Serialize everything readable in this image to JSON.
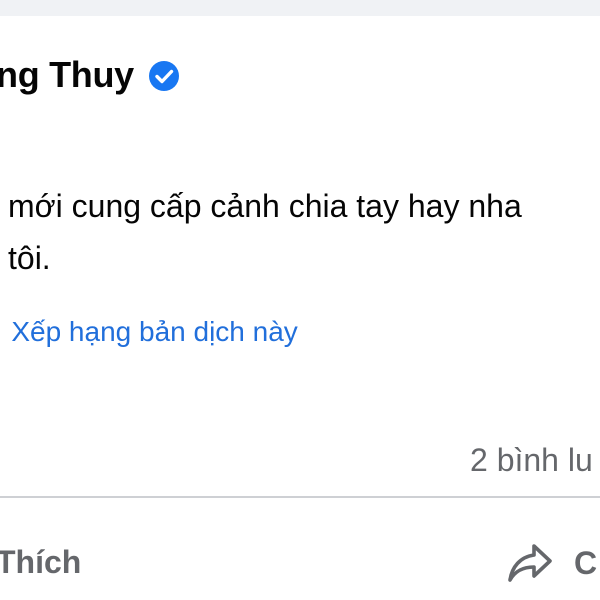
{
  "post": {
    "author_name": "ng Thuy",
    "text_line1": "mới cung cấp cảnh chia tay hay nha",
    "text_line2": "tôi.",
    "translate_bullet": "·",
    "translate_link": "Xếp hạng bản dịch này",
    "comment_count": "2 bình lu"
  },
  "actions": {
    "like_label": "Thích",
    "share_label": "C"
  },
  "icons": {
    "verified": "verified-badge-icon",
    "share": "share-arrow-icon"
  },
  "colors": {
    "accent": "#216fdb",
    "verified_blue": "#1877f2",
    "text_primary": "#050505",
    "text_secondary": "#65676b",
    "page_background": "#f0f2f5",
    "divider": "#ced0d4"
  }
}
